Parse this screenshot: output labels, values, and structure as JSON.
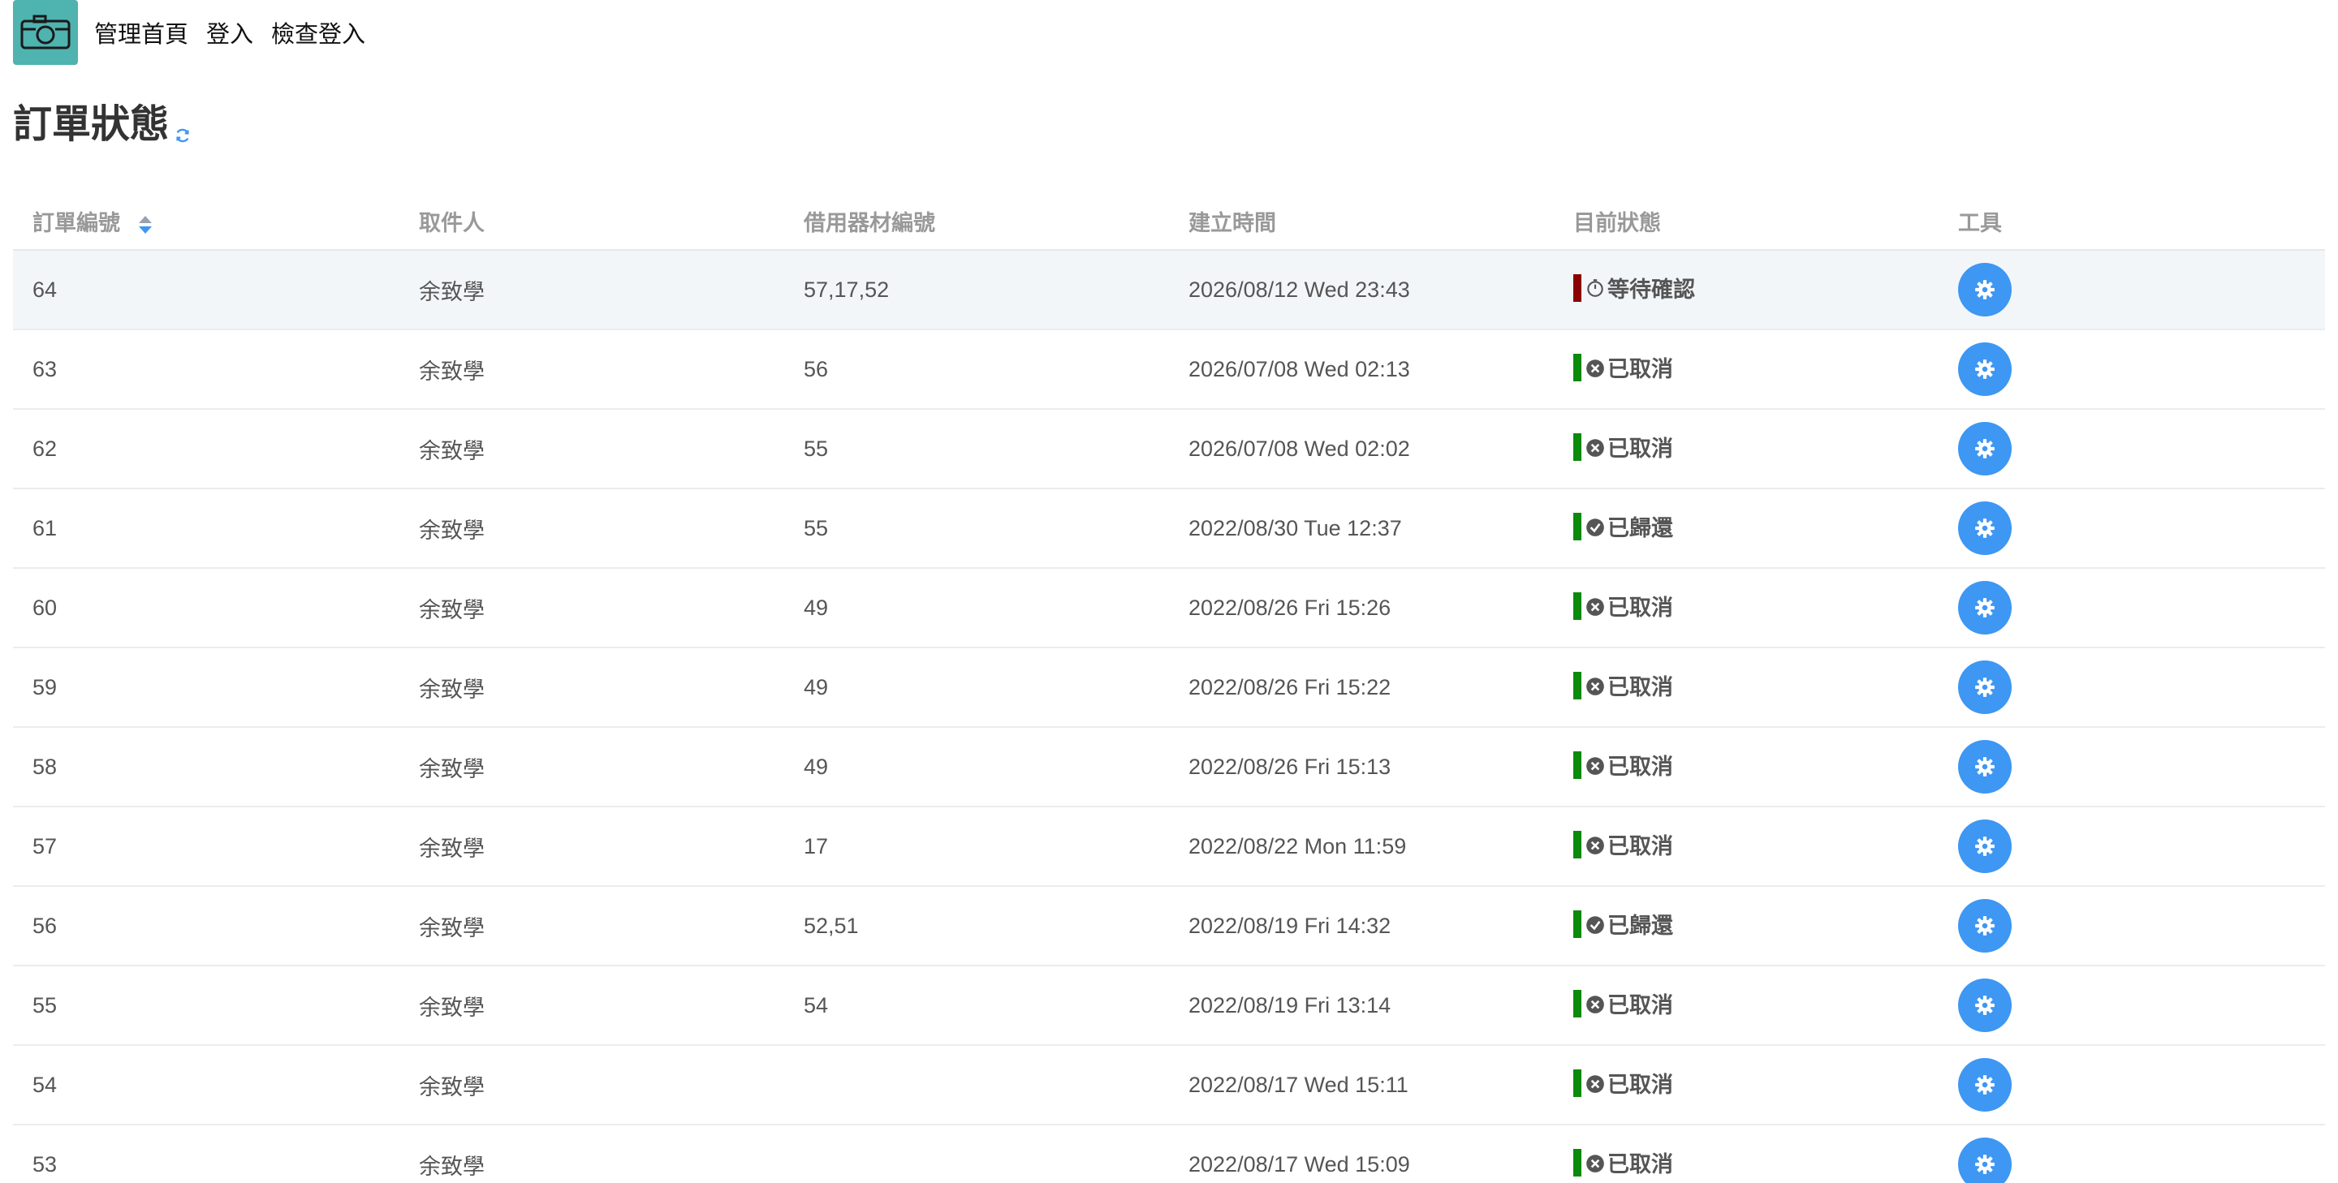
{
  "nav": {
    "items": [
      {
        "label": "管理首頁"
      },
      {
        "label": "登入"
      },
      {
        "label": "檢查登入"
      }
    ]
  },
  "page": {
    "title": "訂單狀態"
  },
  "table": {
    "headers": {
      "id": "訂單編號",
      "pickup": "取件人",
      "equipment": "借用器材編號",
      "created": "建立時間",
      "status": "目前狀態",
      "tools": "工具"
    },
    "rows": [
      {
        "id": "64",
        "pickup": "余致學",
        "equipment": "57,17,52",
        "created": "2026/08/12 Wed 23:43",
        "status": "等待確認",
        "status_icon": "timer-icon",
        "bar_color": "#8b0000"
      },
      {
        "id": "63",
        "pickup": "余致學",
        "equipment": "56",
        "created": "2026/07/08 Wed 02:13",
        "status": "已取消",
        "status_icon": "cancel-circle-icon",
        "bar_color": "#0b8a0b"
      },
      {
        "id": "62",
        "pickup": "余致學",
        "equipment": "55",
        "created": "2026/07/08 Wed 02:02",
        "status": "已取消",
        "status_icon": "cancel-circle-icon",
        "bar_color": "#0b8a0b"
      },
      {
        "id": "61",
        "pickup": "余致學",
        "equipment": "55",
        "created": "2022/08/30 Tue 12:37",
        "status": "已歸還",
        "status_icon": "check-circle-icon",
        "bar_color": "#0b8a0b"
      },
      {
        "id": "60",
        "pickup": "余致學",
        "equipment": "49",
        "created": "2022/08/26 Fri 15:26",
        "status": "已取消",
        "status_icon": "cancel-circle-icon",
        "bar_color": "#0b8a0b"
      },
      {
        "id": "59",
        "pickup": "余致學",
        "equipment": "49",
        "created": "2022/08/26 Fri 15:22",
        "status": "已取消",
        "status_icon": "cancel-circle-icon",
        "bar_color": "#0b8a0b"
      },
      {
        "id": "58",
        "pickup": "余致學",
        "equipment": "49",
        "created": "2022/08/26 Fri 15:13",
        "status": "已取消",
        "status_icon": "cancel-circle-icon",
        "bar_color": "#0b8a0b"
      },
      {
        "id": "57",
        "pickup": "余致學",
        "equipment": "17",
        "created": "2022/08/22 Mon 11:59",
        "status": "已取消",
        "status_icon": "cancel-circle-icon",
        "bar_color": "#0b8a0b"
      },
      {
        "id": "56",
        "pickup": "余致學",
        "equipment": "52,51",
        "created": "2022/08/19 Fri 14:32",
        "status": "已歸還",
        "status_icon": "check-circle-icon",
        "bar_color": "#0b8a0b"
      },
      {
        "id": "55",
        "pickup": "余致學",
        "equipment": "54",
        "created": "2022/08/19 Fri 13:14",
        "status": "已取消",
        "status_icon": "cancel-circle-icon",
        "bar_color": "#0b8a0b"
      },
      {
        "id": "54",
        "pickup": "余致學",
        "equipment": "",
        "created": "2022/08/17 Wed 15:11",
        "status": "已取消",
        "status_icon": "cancel-circle-icon",
        "bar_color": "#0b8a0b"
      },
      {
        "id": "53",
        "pickup": "余致學",
        "equipment": "",
        "created": "2022/08/17 Wed 15:09",
        "status": "已取消",
        "status_icon": "cancel-circle-icon",
        "bar_color": "#0b8a0b"
      }
    ]
  },
  "colors": {
    "logo_bg": "#4fb3b0",
    "tool_button": "#3d97f3",
    "pending_bar": "#8b0000",
    "done_bar": "#0b8a0b",
    "highlight_row": "#f3f6f9"
  }
}
